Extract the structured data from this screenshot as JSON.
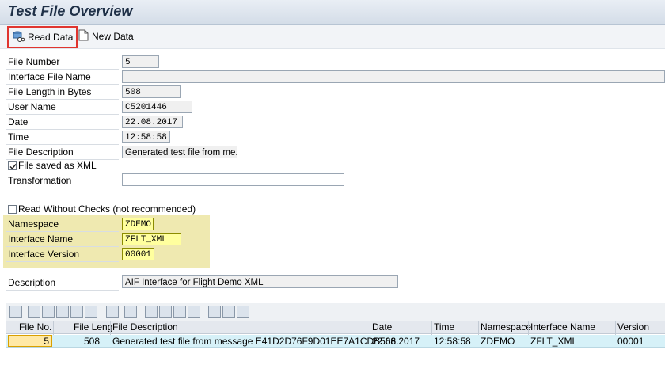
{
  "title": "Test File Overview",
  "toolbar": {
    "read_data": "Read Data",
    "new_data": "New Data"
  },
  "form": {
    "file_number": {
      "label": "File Number",
      "value": "5"
    },
    "interface_file_name": {
      "label": "Interface File Name",
      "value": ""
    },
    "file_length": {
      "label": "File Length in Bytes",
      "value": "508"
    },
    "user_name": {
      "label": "User Name",
      "value": "C5201446"
    },
    "date": {
      "label": "Date",
      "value": "22.08.2017"
    },
    "time": {
      "label": "Time",
      "value": "12:58:58"
    },
    "file_description": {
      "label": "File Description",
      "value": "Generated test file from me.."
    },
    "saved_as_xml": {
      "label": "File saved as XML",
      "checked": true
    },
    "transformation": {
      "label": "Transformation",
      "value": ""
    },
    "read_without_checks": {
      "label": "Read Without Checks (not recommended)",
      "checked": false
    },
    "namespace": {
      "label": "Namespace",
      "value": "ZDEMO"
    },
    "interface_name": {
      "label": "Interface Name",
      "value": "ZFLT_XML"
    },
    "interface_version": {
      "label": "Interface Version",
      "value": "00001"
    },
    "description": {
      "label": "Description",
      "value": "AIF Interface for Flight Demo XML"
    }
  },
  "grid": {
    "columns": [
      "File No.",
      "File Leng",
      "File Description",
      "Date",
      "Time",
      "Namespace",
      "Interface Name",
      "Version"
    ],
    "rows": [
      {
        "file_no": "5",
        "file_length": "508",
        "file_description": "Generated test file from message E41D2D76F9D01EE7A1CDB566..",
        "date": "22.08.2017",
        "time": "12:58:58",
        "namespace": "ZDEMO",
        "interface_name": "ZFLT_XML",
        "version": "00001"
      }
    ]
  },
  "colors": {
    "highlight_border": "#e0352f",
    "input_yellow": "#ffff9e",
    "row_blue": "#d6f1f8"
  }
}
